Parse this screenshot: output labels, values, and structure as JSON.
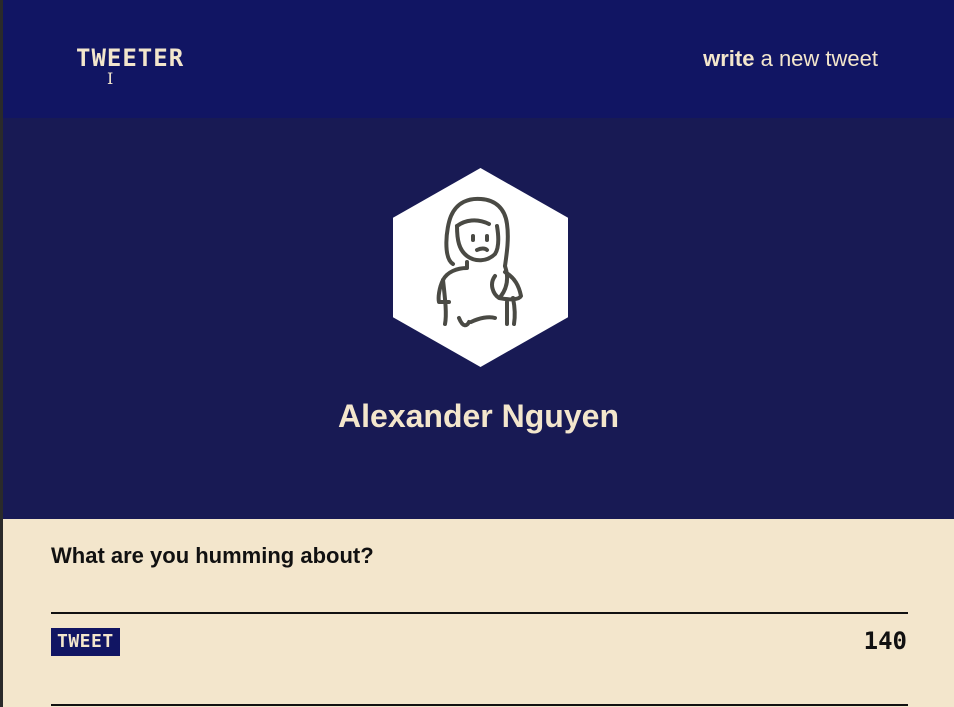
{
  "header": {
    "logo": "TWEETER",
    "compose_strong": "write",
    "compose_rest": " a new tweet"
  },
  "profile": {
    "name": "Alexander Nguyen",
    "avatar_icon": "person-icon"
  },
  "compose": {
    "placeholder": "What are you humming about?",
    "button_label": "TWEET",
    "char_counter": "140"
  },
  "colors": {
    "nav_bg": "#111563",
    "profile_bg": "#181a54",
    "cream": "#f3e6cc",
    "button_bg": "#111563"
  }
}
